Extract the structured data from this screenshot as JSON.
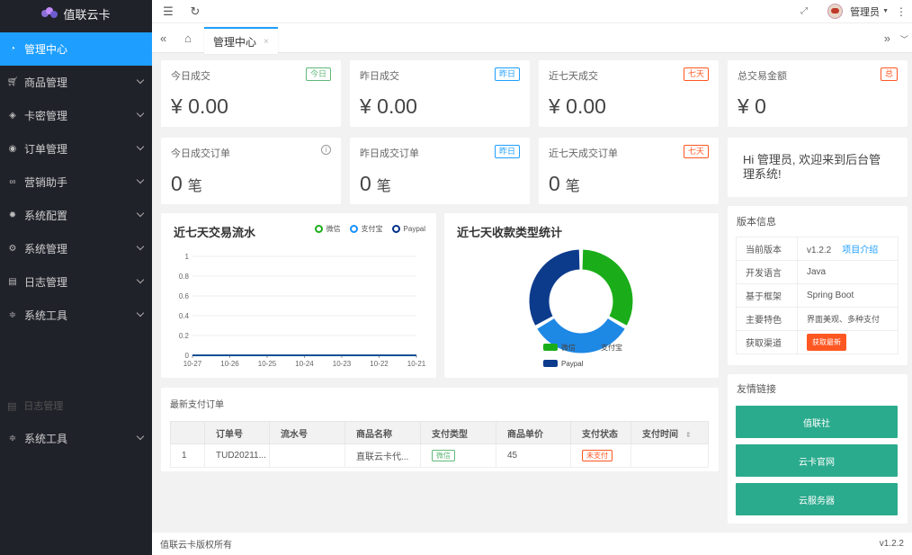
{
  "brand": {
    "name": "值联云卡"
  },
  "sidebar": {
    "items": [
      {
        "label": "管理中心",
        "icon": "dashboard-icon",
        "active": true
      },
      {
        "label": "商品管理",
        "icon": "cart-icon"
      },
      {
        "label": "卡密管理",
        "icon": "layers-icon"
      },
      {
        "label": "订单管理",
        "icon": "order-icon"
      },
      {
        "label": "营销助手",
        "icon": "link-icon"
      },
      {
        "label": "系统配置",
        "icon": "gear-icon"
      },
      {
        "label": "系统管理",
        "icon": "settings-icon"
      },
      {
        "label": "日志管理",
        "icon": "log-icon"
      },
      {
        "label": "系统工具",
        "icon": "tools-icon"
      }
    ],
    "ghost_item": {
      "label": "日志管理"
    },
    "extra_item": {
      "label": "系统工具",
      "icon": "tools-icon"
    }
  },
  "topbar": {
    "user": "管理员"
  },
  "tabs": [
    {
      "label": "管理中心",
      "close": "×"
    }
  ],
  "stats": [
    {
      "title": "今日成交",
      "badge": "今日",
      "badge_color": "green",
      "value": "¥ 0.00"
    },
    {
      "title": "昨日成交",
      "badge": "昨日",
      "badge_color": "blue",
      "value": "¥ 0.00"
    },
    {
      "title": "近七天成交",
      "badge": "七天",
      "badge_color": "red",
      "value": "¥ 0.00"
    },
    {
      "title": "总交易金额",
      "badge": "总",
      "badge_color": "red",
      "value": "¥ 0"
    },
    {
      "title": "今日成交订单",
      "info": true,
      "value": "0",
      "unit": "笔"
    },
    {
      "title": "昨日成交订单",
      "badge": "昨日",
      "badge_color": "blue",
      "value": "0",
      "unit": "笔"
    },
    {
      "title": "近七天成交订单",
      "badge": "七天",
      "badge_color": "red",
      "value": "0",
      "unit": "笔"
    }
  ],
  "welcome": "Hi 管理员, 欢迎来到后台管理系统!",
  "version": {
    "title": "版本信息",
    "rows": [
      {
        "k": "当前版本",
        "v": "v1.2.2",
        "link": "项目介绍"
      },
      {
        "k": "开发语言",
        "v": "Java"
      },
      {
        "k": "基于框架",
        "v": "Spring Boot"
      },
      {
        "k": "主要特色",
        "v": "界面美观、多种支付"
      },
      {
        "k": "获取渠道",
        "button": "获取最新"
      }
    ]
  },
  "links": {
    "title": "友情链接",
    "items": [
      "值联社",
      "云卡官网",
      "云服务器"
    ]
  },
  "line_chart": {
    "title": "近七天交易流水"
  },
  "pie_chart": {
    "title": "近七天收款类型统计"
  },
  "chart_data": [
    {
      "type": "line",
      "title": "近七天交易流水",
      "categories": [
        "10-27",
        "10-26",
        "10-25",
        "10-24",
        "10-23",
        "10-22",
        "10-21"
      ],
      "series": [
        {
          "name": "微信",
          "values": [
            0,
            0,
            0,
            0,
            0,
            0,
            0
          ],
          "color": "#1aad19"
        },
        {
          "name": "支付宝",
          "values": [
            0,
            0,
            0,
            0,
            0,
            0,
            0
          ],
          "color": "#1890ff"
        },
        {
          "name": "Paypal",
          "values": [
            0,
            0,
            0,
            0,
            0,
            0,
            0
          ],
          "color": "#003087"
        }
      ],
      "yticks": [
        "0",
        "0.2",
        "0.4",
        "0.6",
        "0.8",
        "1"
      ],
      "ylim": [
        0,
        1
      ],
      "legend": "top-right",
      "grid": true
    },
    {
      "type": "pie",
      "title": "近七天收款类型统计",
      "slices": [
        {
          "name": "微信",
          "value": 1,
          "color": "#1aad19"
        },
        {
          "name": "支付宝",
          "value": 1,
          "color": "#1e88e5"
        },
        {
          "name": "Paypal",
          "value": 1,
          "color": "#0d3b8c"
        }
      ],
      "legend": "bottom"
    }
  ],
  "orders": {
    "title": "最新支付订单",
    "headers": [
      "",
      "订单号",
      "流水号",
      "商品名称",
      "支付类型",
      "商品单价",
      "支付状态",
      "支付时间"
    ],
    "rows": [
      {
        "idx": "1",
        "order_no": "TUD20211...",
        "serial": "",
        "product": "直联云卡代...",
        "pay_type": "微信",
        "price": "45",
        "status": "未支付",
        "time": ""
      }
    ]
  },
  "footer": {
    "left": "值联云卡版权所有",
    "right": "v1.2.2"
  }
}
